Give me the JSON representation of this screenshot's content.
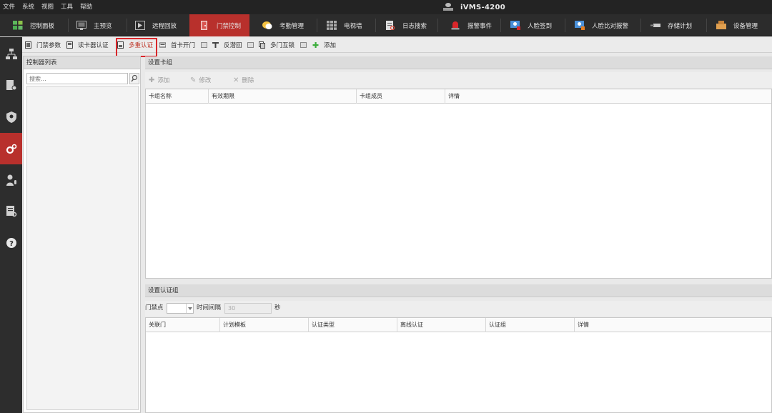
{
  "menu": [
    "文件",
    "系统",
    "视图",
    "工具",
    "帮助"
  ],
  "app_title": "iVMS-4200",
  "modules": [
    {
      "label": "控制面板",
      "icon": "grid-icon"
    },
    {
      "label": "主预览",
      "icon": "monitor-icon"
    },
    {
      "label": "远程回放",
      "icon": "playback-icon"
    },
    {
      "label": "门禁控制",
      "icon": "door-icon"
    },
    {
      "label": "考勤管理",
      "icon": "attendance-icon"
    },
    {
      "label": "电视墙",
      "icon": "video-wall-icon"
    },
    {
      "label": "日志搜索",
      "icon": "log-icon"
    },
    {
      "label": "报警事件",
      "icon": "alarm-icon"
    },
    {
      "label": "人脸签到",
      "icon": "face-checkin-icon"
    },
    {
      "label": "人脸比对报警",
      "icon": "face-compare-icon"
    },
    {
      "label": "存储计划",
      "icon": "storage-icon"
    },
    {
      "label": "设备管理",
      "icon": "device-icon"
    }
  ],
  "subtabs": [
    {
      "label": "门禁参数",
      "icon": "door-params-icon"
    },
    {
      "label": "读卡器认证",
      "icon": "card-reader-icon"
    },
    {
      "label": "多重认证",
      "icon": "multi-auth-icon"
    },
    {
      "label": "首卡开门",
      "icon": "first-card-icon"
    },
    {
      "label": "反潜回",
      "icon": "anti-passback-icon"
    },
    {
      "label": "多门互锁",
      "icon": "interlock-icon"
    },
    {
      "label": "添加",
      "icon": "plus-icon"
    }
  ],
  "left_panel": {
    "title": "控制器列表",
    "search_placeholder": "搜索..."
  },
  "card_group": {
    "title": "设置卡组",
    "actions": [
      "添加",
      "修改",
      "删除"
    ],
    "columns": [
      "卡组名称",
      "有效期限",
      "卡组成员",
      "详情"
    ]
  },
  "auth_group": {
    "title": "设置认证组",
    "door_label": "门禁点",
    "interval_label": "时间间隔",
    "interval_value": "30",
    "unit": "秒",
    "columns": [
      "关联门",
      "计划模板",
      "认证类型",
      "离线认证",
      "认证组",
      "详情"
    ]
  },
  "colors": {
    "accent": "#b8302c",
    "highlight": "#d9262a"
  }
}
